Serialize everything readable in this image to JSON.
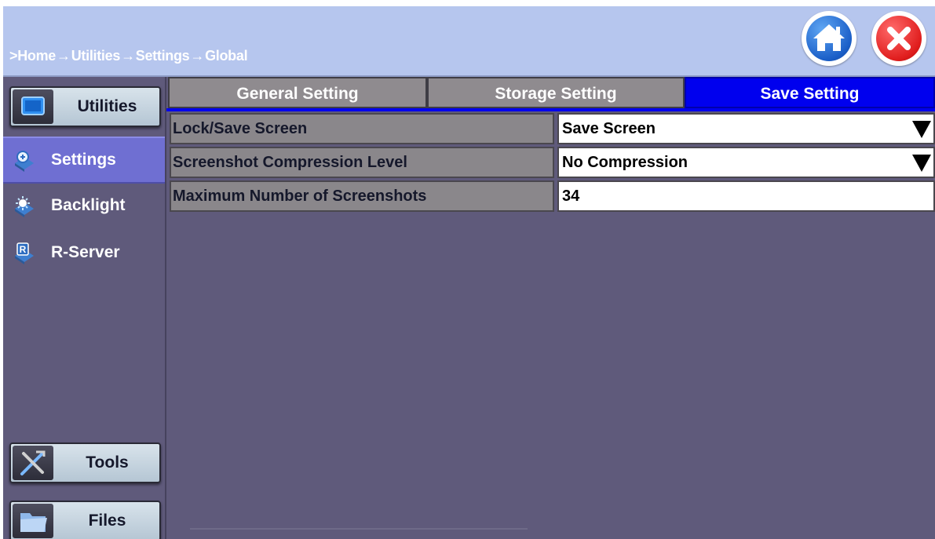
{
  "header": {
    "breadcrumb": [
      ">Home",
      "Utilities",
      "Settings",
      "Global"
    ],
    "breadcrumb_separator": "→",
    "home_button_icon": "home-icon",
    "close_button_icon": "close-icon"
  },
  "sidebar": {
    "utilities_label": "Utilities",
    "items": [
      {
        "label": "Settings",
        "icon": "settings-icon",
        "active": true
      },
      {
        "label": "Backlight",
        "icon": "backlight-icon",
        "active": false
      },
      {
        "label": "R-Server",
        "icon": "r-server-icon",
        "active": false
      }
    ],
    "tools_label": "Tools",
    "files_label": "Files"
  },
  "tabs": [
    {
      "label": "General Setting",
      "active": false
    },
    {
      "label": "Storage Setting",
      "active": false
    },
    {
      "label": "Save Setting",
      "active": true
    }
  ],
  "settings": [
    {
      "label": "Lock/Save Screen",
      "value": "Save Screen",
      "type": "dropdown"
    },
    {
      "label": "Screenshot Compression Level",
      "value": "No Compression",
      "type": "dropdown"
    },
    {
      "label": "Maximum Number of Screenshots",
      "value": "34",
      "type": "input"
    }
  ],
  "colors": {
    "header_bg": "#b6c6ee",
    "panel_bg": "#5f5a7b",
    "active_tab": "#0000ee",
    "active_side_item": "#6f6fd2"
  }
}
